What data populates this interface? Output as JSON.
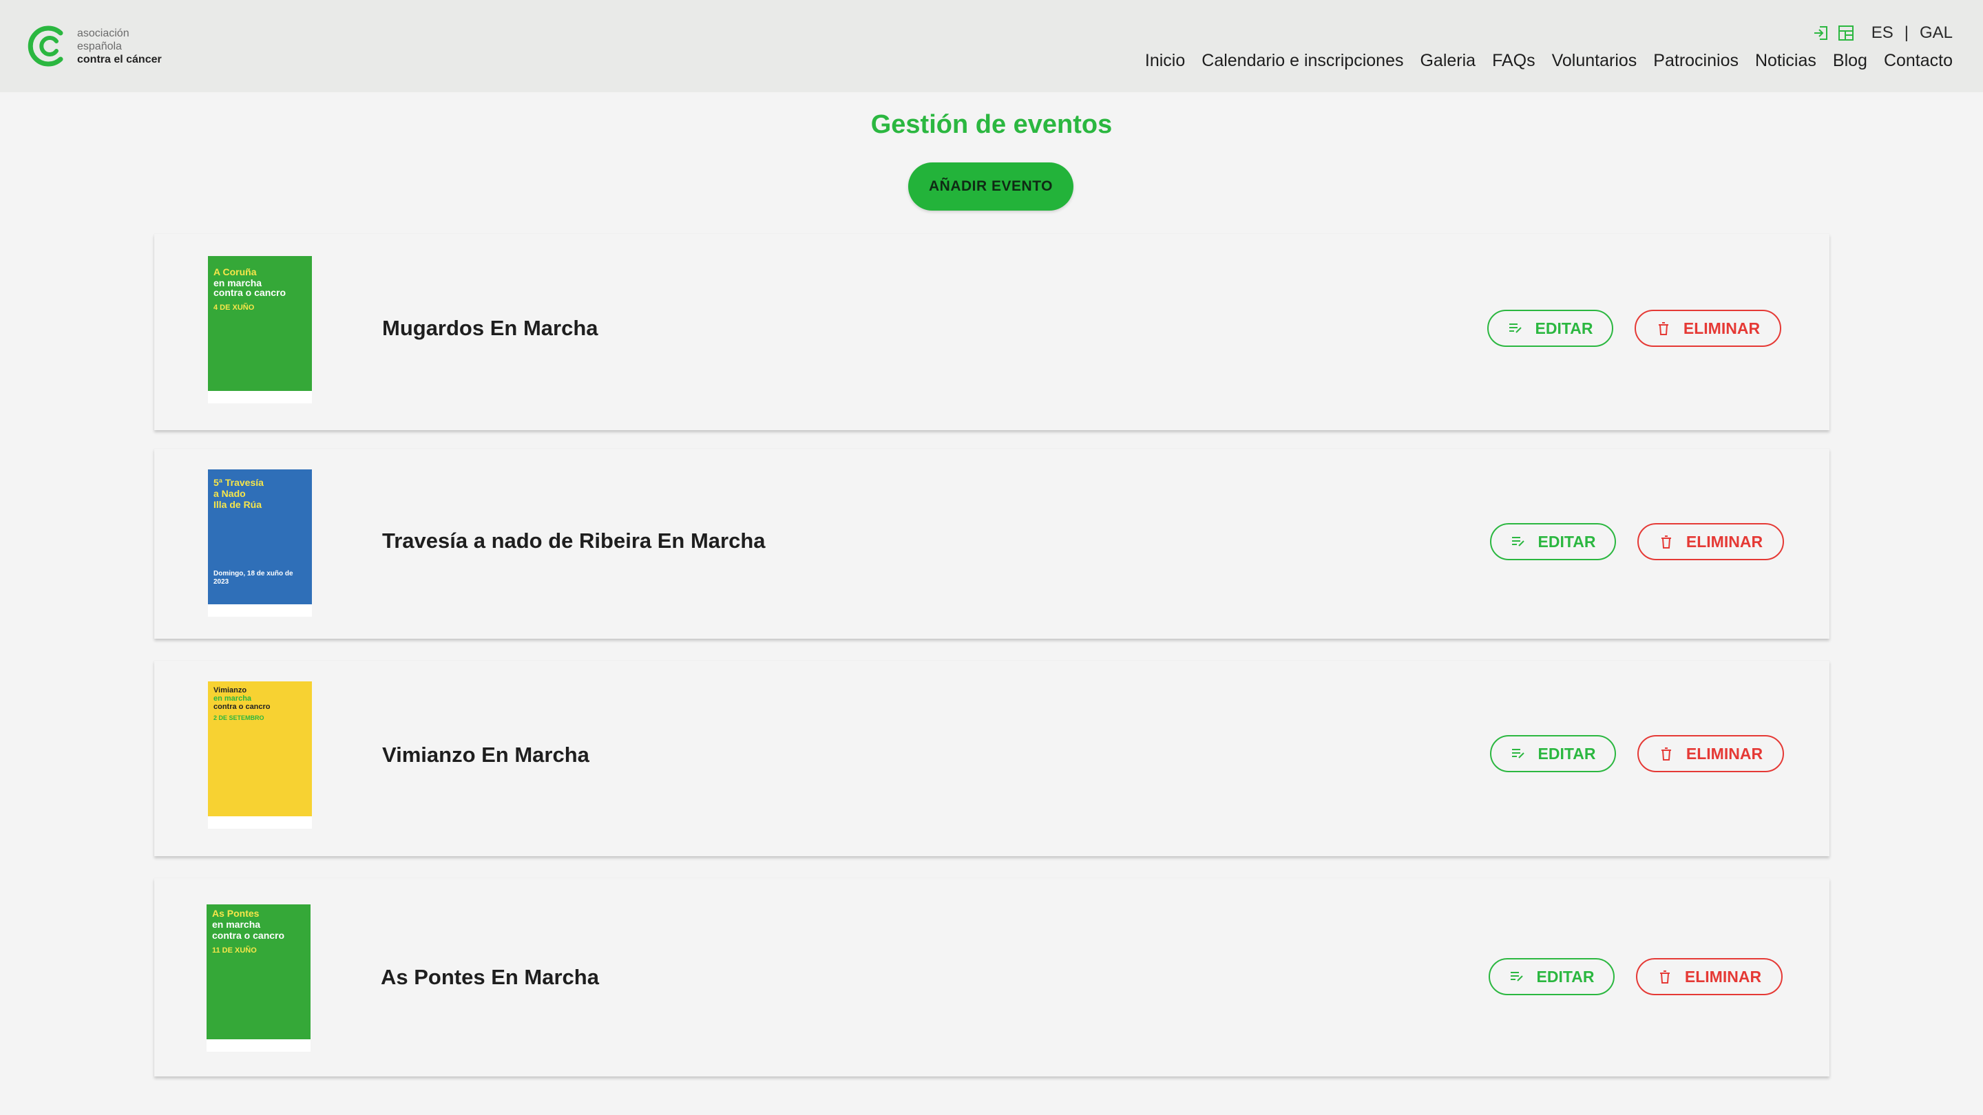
{
  "brand": {
    "line1": "asociación",
    "line2": "española",
    "line3": "contra el cáncer",
    "color": "#2bb740"
  },
  "utility": {
    "icons": [
      "login-icon",
      "dashboard-icon"
    ],
    "lang_es": "ES",
    "separator": "|",
    "lang_gal": "GAL"
  },
  "nav": [
    "Inicio",
    "Calendario e inscripciones",
    "Galeria",
    "FAQs",
    "Voluntarios",
    "Patrocinios",
    "Noticias",
    "Blog",
    "Contacto"
  ],
  "page": {
    "title": "Gestión de eventos",
    "add_button": "AÑADIR EVENTO"
  },
  "actions": {
    "edit_label": "EDITAR",
    "delete_label": "ELIMINAR",
    "edit_icon": "edit-icon",
    "delete_icon": "trash-icon"
  },
  "events": [
    {
      "name": "Mugardos En Marcha",
      "poster": {
        "bg": "#35a838",
        "lines": [
          "A Coruña",
          "en marcha",
          "contra o cancro"
        ],
        "date": "4 DE XUÑO"
      }
    },
    {
      "name": "Travesía a nado de Ribeira En Marcha",
      "poster": {
        "bg": "#2f6fb8",
        "lines": [
          "5ª Travesía",
          "a Nado",
          "Illa de Rúa"
        ],
        "date": "Domingo, 18 de xuño de 2023"
      }
    },
    {
      "name": "Vimianzo En Marcha",
      "poster": {
        "bg": "#f7d232",
        "lines": [
          "Vimianzo",
          "en marcha",
          "contra o cancro"
        ],
        "date": "2 DE SETEMBRO"
      }
    },
    {
      "name": "As Pontes En Marcha",
      "poster": {
        "bg": "#35a838",
        "lines": [
          "As Pontes",
          "en marcha",
          "contra o cancro"
        ],
        "date": "11 DE XUÑO"
      }
    }
  ]
}
